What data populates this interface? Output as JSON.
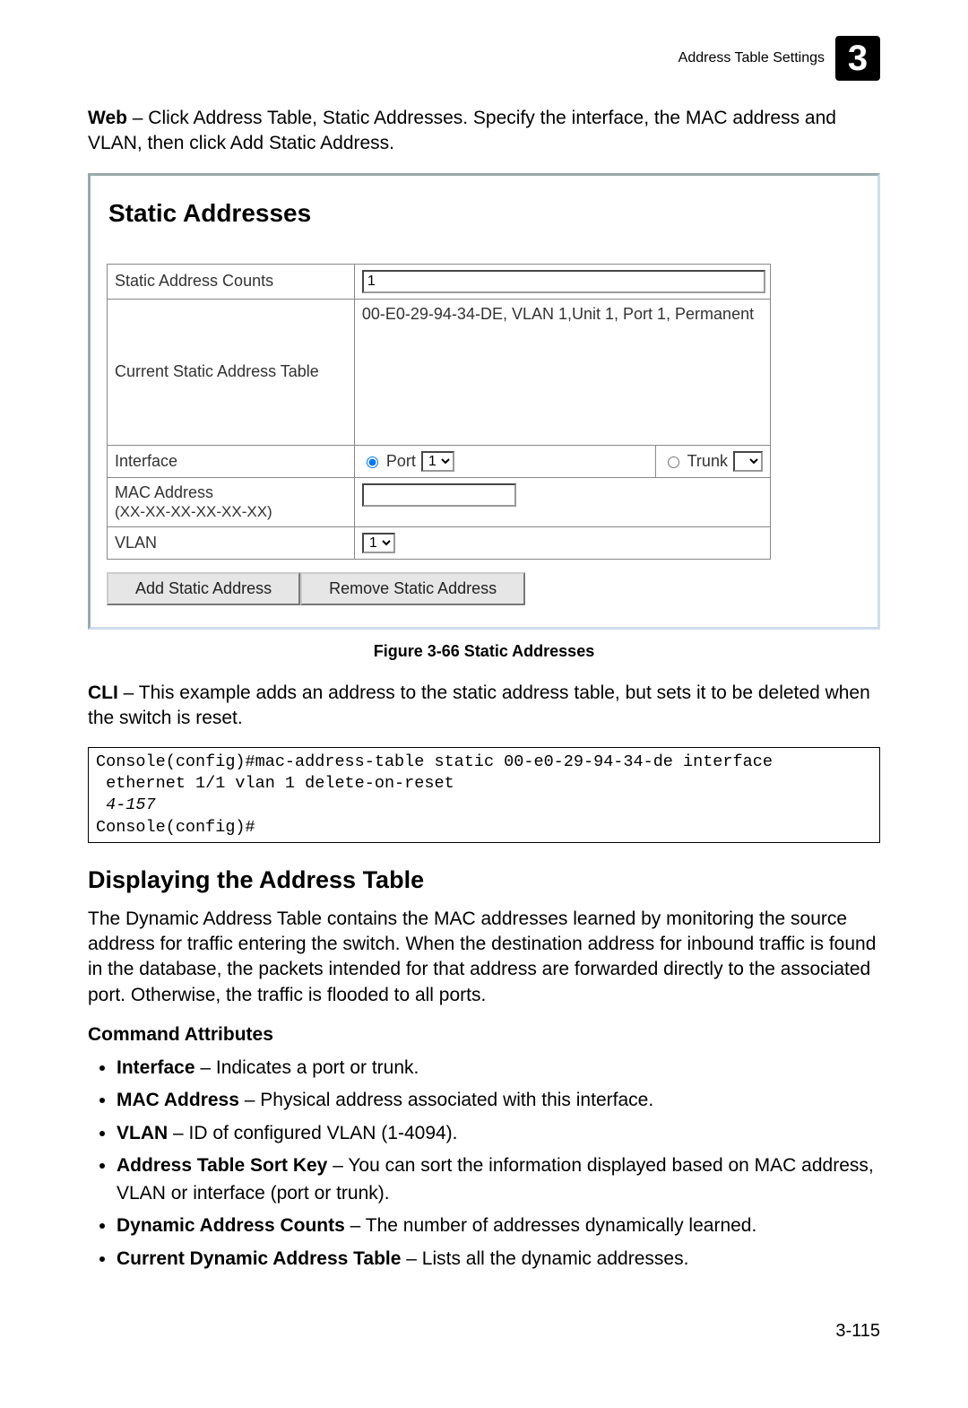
{
  "header": {
    "title": "Address Table Settings",
    "chapter": "3"
  },
  "intro": {
    "web_bold": "Web",
    "web_text": " – Click Address Table, Static Addresses. Specify the interface, the MAC address and VLAN, then click Add Static Address."
  },
  "figure": {
    "title": "Static Addresses",
    "rows": {
      "counts_label": "Static Address Counts",
      "counts_value": "1",
      "table_label": "Current Static Address Table",
      "table_value": "00-E0-29-94-34-DE, VLAN 1,Unit 1, Port 1, Permanent",
      "interface_label": "Interface",
      "port_label": "Port",
      "port_value": "1",
      "trunk_label": "Trunk",
      "mac_label": "MAC Address",
      "mac_hint": "(XX-XX-XX-XX-XX-XX)",
      "vlan_label": "VLAN",
      "vlan_value": "1"
    },
    "buttons": {
      "add": "Add Static Address",
      "remove": "Remove Static Address"
    },
    "caption": "Figure 3-66  Static Addresses"
  },
  "cli": {
    "bold": "CLI",
    "text": " – This example adds an address to the static address table, but sets it to be deleted when the switch is reset.",
    "code_line1": "Console(config)#mac-address-table static 00-e0-29-94-34-de interface",
    "code_line2": " ethernet 1/1 vlan 1 delete-on-reset",
    "code_page_ref": " 4-157",
    "code_line4": "Console(config)#"
  },
  "section": {
    "heading": "Displaying the Address Table",
    "para": "The Dynamic Address Table contains the MAC addresses learned by monitoring the source address for traffic entering the switch. When the destination address for inbound traffic is found in the database, the packets intended for that address are forwarded directly to the associated port. Otherwise, the traffic is flooded to all ports.",
    "attrs_heading": "Command Attributes",
    "attrs": [
      {
        "term": "Interface",
        "desc": " – Indicates a port or trunk."
      },
      {
        "term": "MAC Address",
        "desc": " – Physical address associated with this interface."
      },
      {
        "term": "VLAN",
        "desc": " – ID of configured VLAN (1-4094)."
      },
      {
        "term": "Address Table Sort Key",
        "desc": " – You can sort the information displayed based on MAC address, VLAN or interface (port or trunk)."
      },
      {
        "term": "Dynamic Address Counts",
        "desc": " – The number of addresses dynamically learned."
      },
      {
        "term": "Current Dynamic Address Table",
        "desc": " – Lists all the dynamic addresses."
      }
    ]
  },
  "page_number": "3-115"
}
